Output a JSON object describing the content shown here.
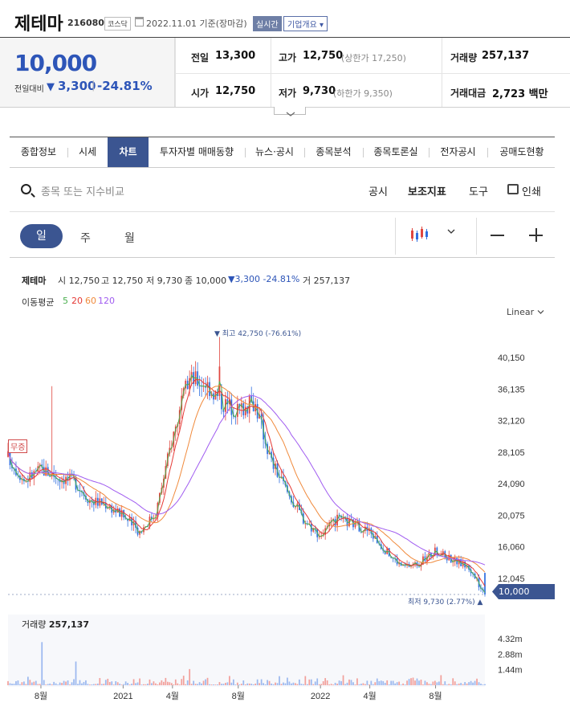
{
  "header": {
    "title": "제테마",
    "code": "216080",
    "market": "코스닥",
    "date": "2022.11.01 기준(장마감)",
    "live_label": "실시간",
    "overview_label": "기업개요 ▾"
  },
  "quote": {
    "price": "10,000",
    "change_label": "전일대비",
    "change_arrow": "▼",
    "change": "3,300",
    "change_sep": "|",
    "change_pct": "-24.81%"
  },
  "stats": {
    "prev_label": "전일",
    "prev": "13,300",
    "high_label": "고가",
    "high": "12,750",
    "upper_limit": "(상한가 17,250)",
    "vol_label": "거래량",
    "vol": "257,137",
    "open_label": "시가",
    "open": "12,750",
    "low_label": "저가",
    "low": "9,730",
    "lower_limit": "(하한가 9,350)",
    "amt_label": "거래대금",
    "amt": "2,723 백만"
  },
  "tabs": [
    "종합정보",
    "시세",
    "차트",
    "투자자별 매매동향",
    "뉴스·공시",
    "종목분석",
    "종목토론실",
    "전자공시",
    "공매도현황"
  ],
  "toolbar": {
    "search_placeholder": "종목 또는 지수비교",
    "disclosure": "공시",
    "indicator": "보조지표",
    "tools": "도구",
    "print": "인쇄"
  },
  "periods": {
    "day": "일",
    "week": "주",
    "month": "월"
  },
  "chart_info": {
    "name": "제테마",
    "open_label": "시",
    "open": "12,750",
    "high_label": "고",
    "high": "12,750",
    "low_label": "저",
    "low": "9,730",
    "close_label": "종",
    "close": "10,000",
    "change": "▼3,300",
    "change_pct": "-24.81%",
    "vol_label": "거",
    "vol": "257,137",
    "ma_label": "이동평균",
    "ma_periods": [
      "5",
      "20",
      "60",
      "120"
    ]
  },
  "colors": {
    "up": "#e0463f",
    "down": "#2f6fe0",
    "ma5": "#4caf50",
    "ma20": "#e53935",
    "ma60": "#f08a3c",
    "ma120": "#a05cf0",
    "accent": "#3b5591"
  },
  "chart_data": {
    "type": "candlestick",
    "scale": "Linear",
    "y_ticks": [
      "40,150",
      "36,135",
      "32,120",
      "28,105",
      "24,090",
      "20,075",
      "16,060",
      "12,045"
    ],
    "y_tick_values": [
      40150,
      36135,
      32120,
      28105,
      24090,
      20075,
      16060,
      12045
    ],
    "x_ticks": [
      "8월",
      "2021",
      "4월",
      "8월",
      "2022",
      "4월",
      "8월"
    ],
    "x_tick_dates": [
      "2020-08",
      "2021-01",
      "2021-04",
      "2021-08",
      "2022-01",
      "2022-04",
      "2022-08"
    ],
    "date_range": [
      "2020-06",
      "2022-11-01"
    ],
    "high_marker": "▼ 최고 42,750 (-76.61%)",
    "high_value": 42750,
    "low_marker": "최저 9,730 (2.77%) ▲",
    "low_value": 9730,
    "last_price": "10,000",
    "upper_limit_badge": "무증",
    "close_approx": [
      [
        "2020-06",
        27500
      ],
      [
        "2020-07",
        24500
      ],
      [
        "2020-08",
        26000
      ],
      [
        "2020-09",
        25000
      ],
      [
        "2020-10",
        24500
      ],
      [
        "2020-11",
        22000
      ],
      [
        "2020-12",
        21500
      ],
      [
        "2021-01",
        20000
      ],
      [
        "2021-02",
        18000
      ],
      [
        "2021-03",
        20500
      ],
      [
        "2021-04",
        30000
      ],
      [
        "2021-05",
        37500
      ],
      [
        "2021-06",
        37000
      ],
      [
        "2021-07",
        34500
      ],
      [
        "2021-08",
        33500
      ],
      [
        "2021-09",
        34500
      ],
      [
        "2021-10",
        27000
      ],
      [
        "2021-11",
        23000
      ],
      [
        "2021-12",
        19500
      ],
      [
        "2022-01",
        17500
      ],
      [
        "2022-02",
        19500
      ],
      [
        "2022-03",
        19000
      ],
      [
        "2022-04",
        18000
      ],
      [
        "2022-05",
        15500
      ],
      [
        "2022-06",
        13500
      ],
      [
        "2022-07",
        14000
      ],
      [
        "2022-08",
        15500
      ],
      [
        "2022-09",
        14500
      ],
      [
        "2022-10",
        13500
      ],
      [
        "2022-11-01",
        10000
      ]
    ],
    "volume": {
      "label": "거래량",
      "value": "257,137",
      "y_ticks": [
        "4.32m",
        "2.88m",
        "1.44m"
      ],
      "y_tick_values": [
        4320000,
        2880000,
        1440000
      ]
    }
  }
}
